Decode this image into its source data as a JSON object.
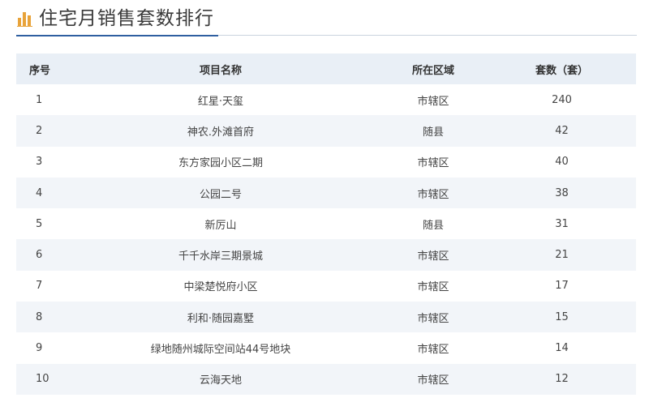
{
  "header": {
    "title": "住宅月销售套数排行",
    "icon": "bar-chart-icon",
    "icon_color": "#e8a33a",
    "rule_color": "#2f5fa0"
  },
  "table": {
    "columns": [
      "序号",
      "项目名称",
      "所在区域",
      "套数（套）"
    ],
    "rows": [
      {
        "rank": "1",
        "project": "红星·天玺",
        "area": "市辖区",
        "units": "240"
      },
      {
        "rank": "2",
        "project": "神农.外滩首府",
        "area": "随县",
        "units": "42"
      },
      {
        "rank": "3",
        "project": "东方家园小区二期",
        "area": "市辖区",
        "units": "40"
      },
      {
        "rank": "4",
        "project": "公园二号",
        "area": "市辖区",
        "units": "38"
      },
      {
        "rank": "5",
        "project": "新厉山",
        "area": "随县",
        "units": "31"
      },
      {
        "rank": "6",
        "project": "千千水岸三期景城",
        "area": "市辖区",
        "units": "21"
      },
      {
        "rank": "7",
        "project": "中梁楚悦府小区",
        "area": "市辖区",
        "units": "17"
      },
      {
        "rank": "8",
        "project": "利和·随园嘉墅",
        "area": "市辖区",
        "units": "15"
      },
      {
        "rank": "9",
        "project": "绿地随州城际空间站44号地块",
        "area": "市辖区",
        "units": "14"
      },
      {
        "rank": "10",
        "project": "云海天地",
        "area": "市辖区",
        "units": "12"
      }
    ]
  }
}
